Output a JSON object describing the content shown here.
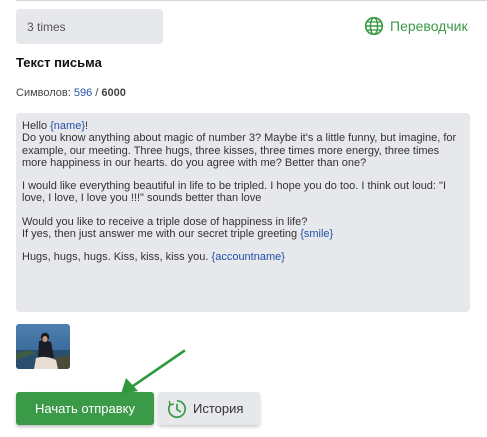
{
  "subject": {
    "value": "3 times"
  },
  "translator": {
    "label": "Переводчик",
    "icon": "globe-icon",
    "color": "#3a9a48"
  },
  "message": {
    "title": "Текст письма",
    "counter_label": "Символов:",
    "counter_current": "596",
    "counter_separator": "/",
    "counter_max": "6000",
    "greeting_prefix": "Hello ",
    "greeting_var": "{name}",
    "greeting_suffix": "!",
    "para1": "Do you know anything about magic of number 3? Maybe it's a little funny, but imagine, for example, our meeting. Three hugs, three kisses, three times more energy, three times more happiness in our hearts. do you agree with me? Better than one?",
    "para2": "I would like everything beautiful in life to be tripled. I hope you do too. I think out loud: \"I love, I love, I love you !!!\" sounds better than love",
    "para3_line1": "Would you like to receive a triple dose of happiness in life?",
    "para3_line2": "If yes, then just answer me with our secret triple greeting ",
    "smile_var": "{smile}",
    "signoff": "Hugs, hugs, hugs. Kiss, kiss, kiss you. ",
    "accountname_var": "{accountname}"
  },
  "attachment": {
    "icon": "photo-thumbnail"
  },
  "actions": {
    "start_label": "Начать отправку",
    "history_label": "История",
    "history_icon": "history-clock-icon",
    "accent_color": "#3b9a47"
  }
}
